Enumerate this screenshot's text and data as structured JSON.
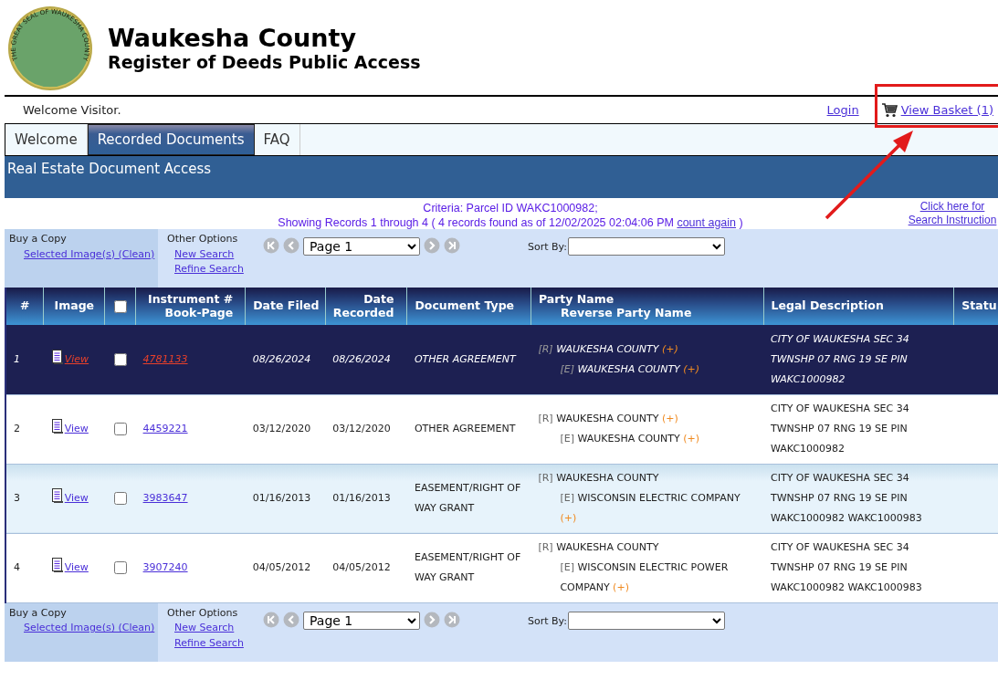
{
  "header": {
    "seal_text": "THE GREAT SEAL OF WAUKESHA COUNTY",
    "title": "Waukesha County",
    "subtitle": "Register of Deeds Public Access"
  },
  "welcome": "Welcome Visitor.",
  "user_links": {
    "login": "Login",
    "basket": "View Basket (1)"
  },
  "tabs": [
    {
      "label": "Welcome",
      "selected": false
    },
    {
      "label": "Recorded Documents",
      "selected": true
    },
    {
      "label": "FAQ",
      "selected": false
    }
  ],
  "section_title": "Real Estate Document Access",
  "criteria": {
    "line1": "Criteria:  Parcel ID WAKC1000982;",
    "line2": "Showing Records 1 through 4 ( 4 records found as of 12/02/2025 02:04:06 PM",
    "count_link": "count again",
    "line2_end": ")",
    "help_link": [
      "Click here for",
      "Search Instruction"
    ]
  },
  "toolbars": [
    {
      "buy_label": "Buy a Copy",
      "buy_link": "Selected Image(s) (Clean)",
      "other_label": "Other Options",
      "other_links": [
        "New Search",
        "Refine Search"
      ],
      "page": "Page 1",
      "sort_label": "Sort By:"
    },
    {
      "buy_label": "Buy a Copy",
      "buy_link": "Selected Image(s) (Clean)",
      "other_label": "Other Options",
      "other_links": [
        "New Search",
        "Refine Search"
      ],
      "page": "Page 1",
      "sort_label": "Sort By:"
    }
  ],
  "table": {
    "columns": [
      {
        "kind": "text",
        "lines": [
          "#"
        ]
      },
      {
        "kind": "text",
        "lines": [
          "Image"
        ]
      },
      {
        "kind": "checkbox",
        "checked": false
      },
      {
        "kind": "text",
        "lines": [
          "Instrument #",
          "Book-Page"
        ]
      },
      {
        "kind": "text",
        "lines": [
          "Date Filed"
        ]
      },
      {
        "kind": "text",
        "lines": [
          "Date",
          "Recorded"
        ]
      },
      {
        "kind": "text",
        "lines": [
          "Document Type"
        ]
      },
      {
        "kind": "text",
        "lines": [
          "Party Name",
          "Reverse Party Name"
        ]
      },
      {
        "kind": "text",
        "lines": [
          "Legal Description"
        ]
      },
      {
        "kind": "text",
        "lines": [
          "Statu"
        ]
      }
    ],
    "rows": [
      {
        "number": "1",
        "view": "View",
        "checked": false,
        "selected": true,
        "instrument": "4781133",
        "date_filed": "08/26/2024",
        "date_recorded": "08/26/2024",
        "document_type": "OTHER AGREEMENT",
        "party": {
          "role": "[R]",
          "name": "WAUKESHA COUNTY",
          "more": "(+)"
        },
        "reverse_party": {
          "role": "[E]",
          "name": "WAUKESHA COUNTY",
          "more": "(+)"
        },
        "legal": "CITY OF WAUKESHA SEC 34 TWNSHP 07 RNG 19 SE PIN WAKC1000982"
      },
      {
        "number": "2",
        "view": "View",
        "checked": false,
        "selected": false,
        "instrument": "4459221",
        "date_filed": "03/12/2020",
        "date_recorded": "03/12/2020",
        "document_type": "OTHER AGREEMENT",
        "party": {
          "role": "[R]",
          "name": "WAUKESHA COUNTY",
          "more": "(+)"
        },
        "reverse_party": {
          "role": "[E]",
          "name": "WAUKESHA COUNTY",
          "more": "(+)"
        },
        "legal": "CITY OF WAUKESHA SEC 34 TWNSHP 07 RNG 19 SE PIN WAKC1000982"
      },
      {
        "number": "3",
        "view": "View",
        "checked": false,
        "selected": false,
        "instrument": "3983647",
        "date_filed": "01/16/2013",
        "date_recorded": "01/16/2013",
        "document_type": "EASEMENT/RIGHT OF WAY GRANT",
        "party": {
          "role": "[R]",
          "name": "WAUKESHA COUNTY"
        },
        "reverse_party": {
          "role": "[E]",
          "name": "WISCONSIN ELECTRIC COMPANY",
          "more": "(+)"
        },
        "legal": "CITY OF WAUKESHA SEC 34 TWNSHP 07 RNG 19 SE PIN WAKC1000982 WAKC1000983"
      },
      {
        "number": "4",
        "view": "View",
        "checked": false,
        "selected": false,
        "instrument": "3907240",
        "date_filed": "04/05/2012",
        "date_recorded": "04/05/2012",
        "document_type": "EASEMENT/RIGHT OF WAY GRANT",
        "party": {
          "role": "[R]",
          "name": "WAUKESHA COUNTY"
        },
        "reverse_party": {
          "role": "[E]",
          "name": "WISCONSIN ELECTRIC POWER COMPANY",
          "more": "(+)"
        },
        "legal": "CITY OF WAUKESHA SEC 34 TWNSHP 07 RNG 19 SE PIN WAKC1000982 WAKC1000983"
      }
    ]
  }
}
